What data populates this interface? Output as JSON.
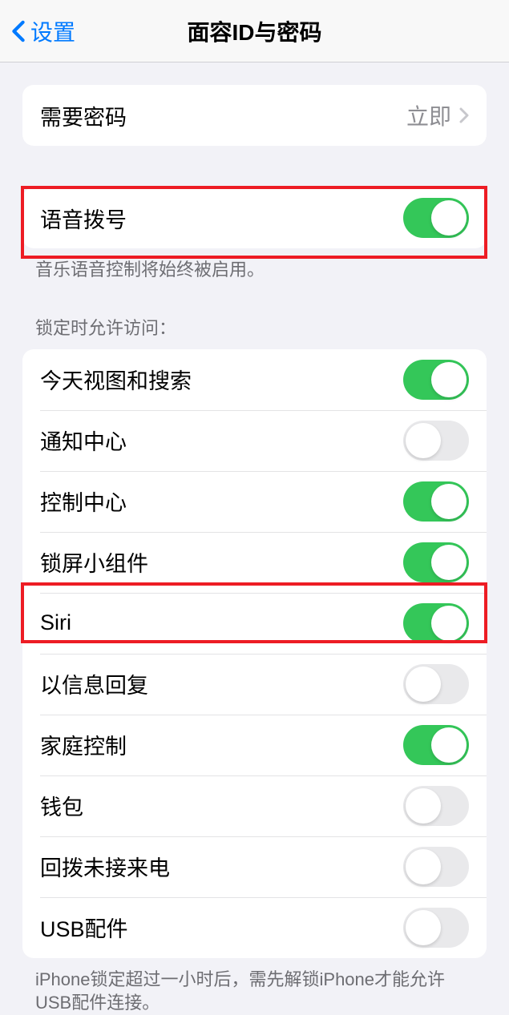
{
  "header": {
    "back_label": "设置",
    "title": "面容ID与密码"
  },
  "passcode": {
    "label": "需要密码",
    "value": "立即"
  },
  "voice_dial": {
    "label": "语音拨号",
    "enabled": true,
    "footer": "音乐语音控制将始终被启用。"
  },
  "lock_access": {
    "header": "锁定时允许访问：",
    "items": [
      {
        "label": "今天视图和搜索",
        "enabled": true
      },
      {
        "label": "通知中心",
        "enabled": false
      },
      {
        "label": "控制中心",
        "enabled": true
      },
      {
        "label": "锁屏小组件",
        "enabled": true
      },
      {
        "label": "Siri",
        "enabled": true
      },
      {
        "label": "以信息回复",
        "enabled": false
      },
      {
        "label": "家庭控制",
        "enabled": true
      },
      {
        "label": "钱包",
        "enabled": false
      },
      {
        "label": "回拨未接来电",
        "enabled": false
      },
      {
        "label": "USB配件",
        "enabled": false
      }
    ],
    "footer": "iPhone锁定超过一小时后，需先解锁iPhone才能允许USB配件连接。"
  }
}
